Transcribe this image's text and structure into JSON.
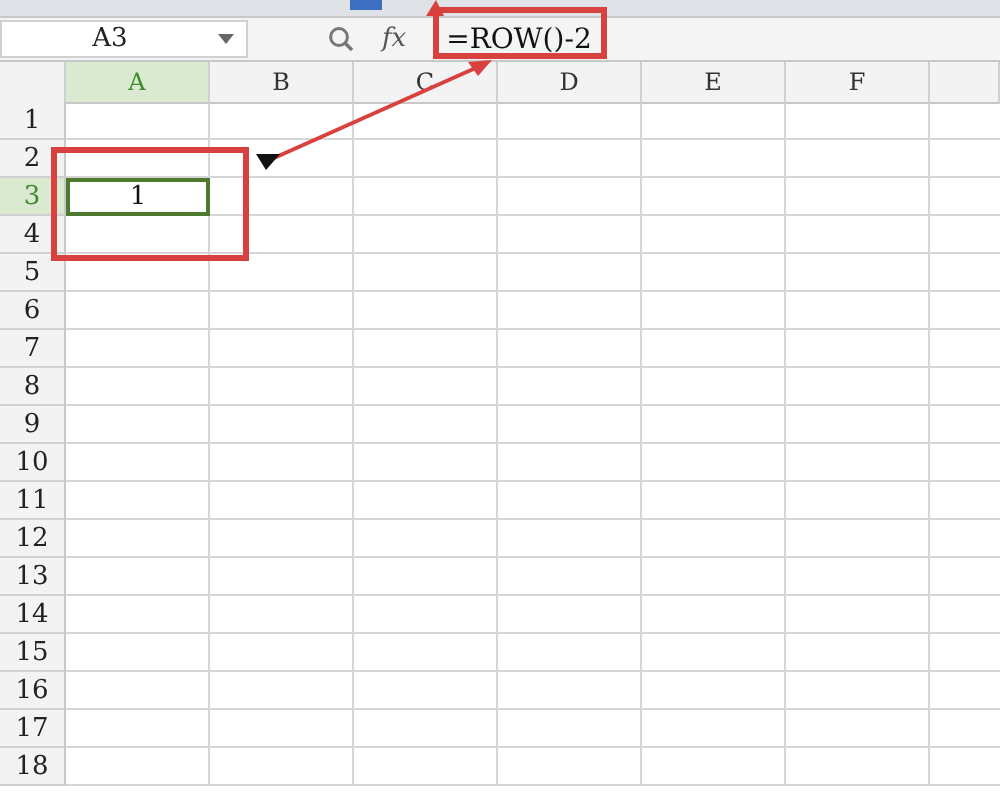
{
  "name_box": {
    "value": "A3"
  },
  "formula_bar": {
    "fx": "fx",
    "formula": "=ROW()-2"
  },
  "columns": [
    {
      "label": "A",
      "selected": true
    },
    {
      "label": "B",
      "selected": false
    },
    {
      "label": "C",
      "selected": false
    },
    {
      "label": "D",
      "selected": false
    },
    {
      "label": "E",
      "selected": false
    },
    {
      "label": "F",
      "selected": false
    }
  ],
  "rows": [
    {
      "label": "1",
      "selected": false
    },
    {
      "label": "2",
      "selected": false
    },
    {
      "label": "3",
      "selected": true,
      "value": "1"
    },
    {
      "label": "4",
      "selected": false
    },
    {
      "label": "5",
      "selected": false
    },
    {
      "label": "6",
      "selected": false
    },
    {
      "label": "7",
      "selected": false
    },
    {
      "label": "8",
      "selected": false
    },
    {
      "label": "9",
      "selected": false
    },
    {
      "label": "10",
      "selected": false
    },
    {
      "label": "11",
      "selected": false
    },
    {
      "label": "12",
      "selected": false
    },
    {
      "label": "13",
      "selected": false
    },
    {
      "label": "14",
      "selected": false
    },
    {
      "label": "15",
      "selected": false
    },
    {
      "label": "16",
      "selected": false
    },
    {
      "label": "17",
      "selected": false
    },
    {
      "label": "18",
      "selected": false
    }
  ]
}
